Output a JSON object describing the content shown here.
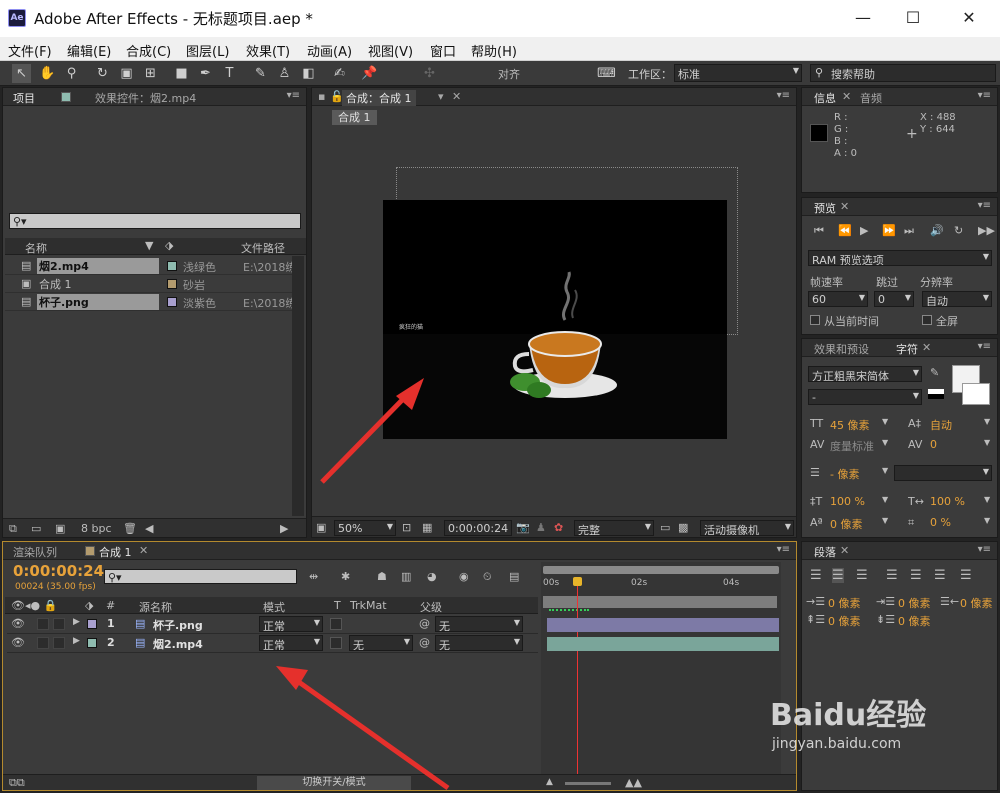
{
  "app": {
    "title": "Adobe After Effects - 无标题项目.aep *",
    "icon_label": "Ae",
    "window_controls": [
      "—",
      "☐",
      "✕"
    ]
  },
  "menu": [
    "文件(F)",
    "编辑(E)",
    "合成(C)",
    "图层(L)",
    "效果(T)",
    "动画(A)",
    "视图(V)",
    "窗口",
    "帮助(H)"
  ],
  "toolbar": {
    "snap_label": "对齐",
    "workspace_label": "工作区：",
    "workspace_value": "标准",
    "search_placeholder": "搜索帮助"
  },
  "project_panel": {
    "tab_project": "项目",
    "tab_effects": "效果控件：烟2.mp4",
    "col_name": "名称",
    "col_path": "文件路径",
    "items": [
      {
        "name": "烟2.mp4",
        "label": "浅绿色",
        "path": "E:\\2018练",
        "color": "#8fbcb0"
      },
      {
        "name": "合成 1",
        "label": "砂岩",
        "path": "",
        "color": "#b39b6e"
      },
      {
        "name": "杯子.png",
        "label": "淡紫色",
        "path": "E:\\2018练",
        "color": "#a9a0cf"
      }
    ],
    "bpc": "8 bpc"
  },
  "comp_panel": {
    "tab": "合成：合成 1",
    "crumb": "合成 1",
    "zoom": "50%",
    "timecode": "0:00:00:24",
    "quality": "完整",
    "camera": "活动摄像机",
    "overlay_text": "疯狂的猫"
  },
  "info_panel": {
    "tab_info": "信息",
    "tab_audio": "音频",
    "r": "R :",
    "g": "G :",
    "b": "B :",
    "a": "A : 0",
    "x": "X : 488",
    "y": "Y : 644"
  },
  "preview_panel": {
    "tab": "预览",
    "ram": "RAM 预览选项",
    "framerate_label": "帧速率",
    "skip_label": "跳过",
    "resolution_label": "分辨率",
    "framerate": "60",
    "skip": "0",
    "resolution": "自动",
    "from_current": "从当前时间",
    "fullscreen": "全屏"
  },
  "character_panel": {
    "tab_effects": "效果和预设",
    "tab_char": "字符",
    "font": "方正粗黑宋简体",
    "style": "-",
    "size": "45 像素",
    "leading": "自动",
    "kerning": "度量标准",
    "tracking": "0",
    "stroke": "- 像素",
    "vscale": "100 %",
    "hscale": "100 %",
    "baseline": "0 像素",
    "tsume": "0 %"
  },
  "paragraph_panel": {
    "tab": "段落",
    "indent_left": "0 像素",
    "indent_first": "0 像素",
    "indent_right": "0 像素",
    "space_before": "0 像素",
    "space_after": "0 像素"
  },
  "timeline": {
    "tab_render": "渲染队列",
    "tab_comp": "合成 1",
    "timecode": "0:00:00:24",
    "fps": "00024 (35.00 fps)",
    "col_num": "#",
    "col_source": "源名称",
    "col_mode": "模式",
    "col_t": "T",
    "col_trkmat": "TrkMat",
    "col_parent": "父级",
    "ruler": [
      "00s",
      "02s",
      "04s"
    ],
    "layers": [
      {
        "num": "1",
        "name": "杯子.png",
        "mode": "正常",
        "trkmat": "",
        "parent": "无",
        "color": "#a9a0cf",
        "bar": "#7d7aa6"
      },
      {
        "num": "2",
        "name": "烟2.mp4",
        "mode": "正常",
        "trkmat": "无",
        "parent": "无",
        "color": "#8fbcb0",
        "bar": "#7aa59a"
      }
    ],
    "footer": "切换开关/模式"
  },
  "watermark": {
    "brand": "Baidu经验",
    "url": "jingyan.baidu.com"
  }
}
